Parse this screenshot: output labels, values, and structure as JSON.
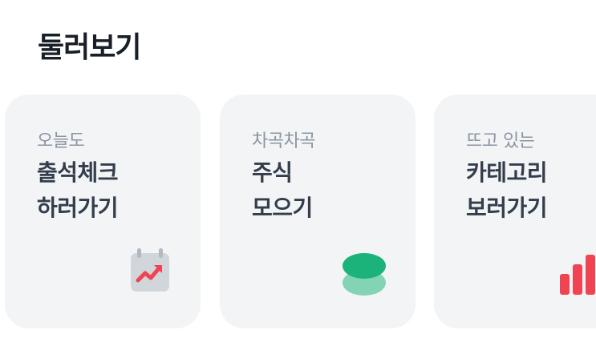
{
  "section": {
    "title": "둘러보기"
  },
  "cards": [
    {
      "subtitle": "오늘도",
      "line1": "출석체크",
      "line2": "하러가기",
      "icon": "calendar-trend-icon"
    },
    {
      "subtitle": "차곡차곡",
      "line1": "주식",
      "line2": "모으기",
      "icon": "coin-stack-icon"
    },
    {
      "subtitle": "뜨고 있는",
      "line1": "카테고리",
      "line2": "보러가기",
      "icon": "bar-chart-icon"
    }
  ],
  "colors": {
    "card_bg": "#f2f4f6",
    "title": "#191f28",
    "subtitle": "#8b95a1",
    "accent_red": "#f04452",
    "accent_green": "#1cb37b"
  }
}
